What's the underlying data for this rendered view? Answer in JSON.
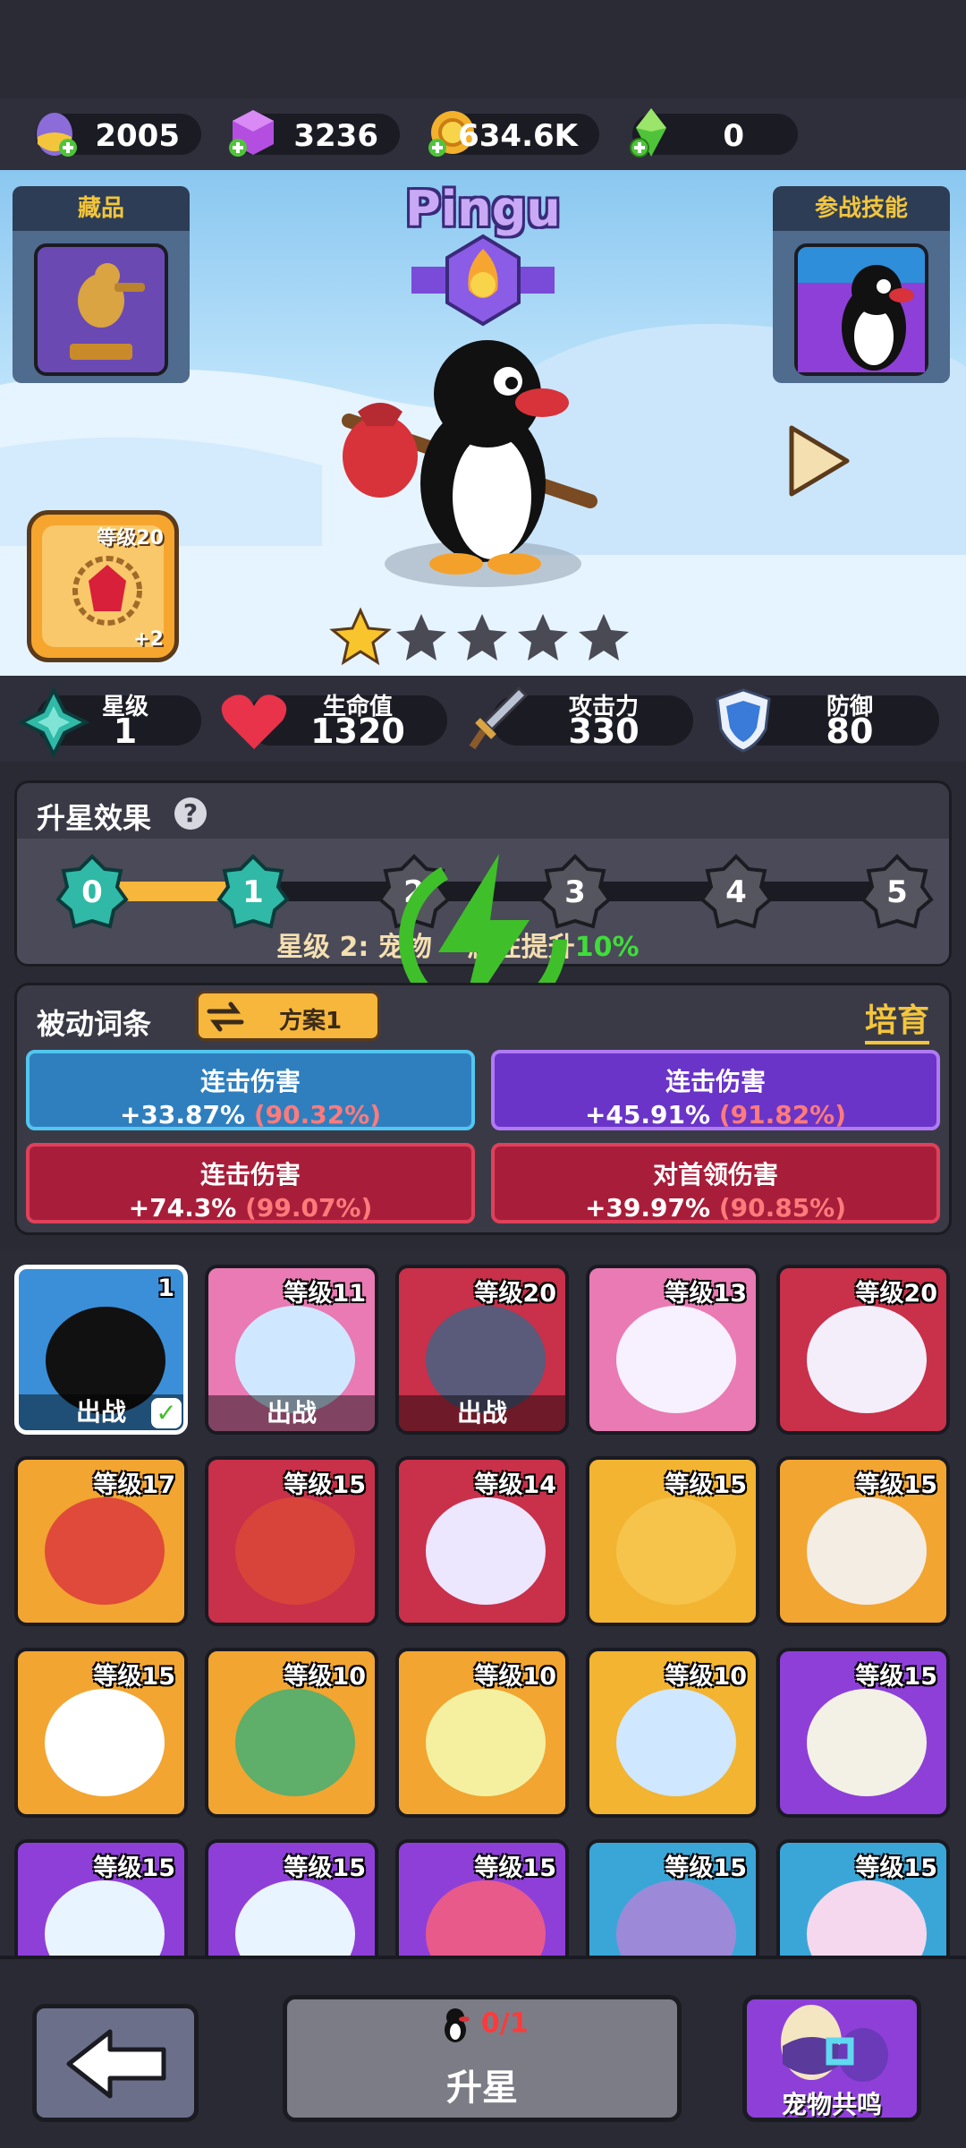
{
  "resources": [
    {
      "icon": "egg-icon",
      "value": "2005"
    },
    {
      "icon": "purple-gem-icon",
      "value": "3236"
    },
    {
      "icon": "gold-coin-icon",
      "value": "634.6K"
    },
    {
      "icon": "green-crystal-icon",
      "value": "0"
    }
  ],
  "hero": {
    "name": "Pingu",
    "collection_label": "藏品",
    "skill_label": "参战技能",
    "level_badge": "等级20",
    "level_plus": "+2",
    "stars_filled": 1,
    "stars_total": 5
  },
  "stats": [
    {
      "label": "星级",
      "value": "1",
      "icon": "star-rank-icon"
    },
    {
      "label": "生命值",
      "value": "1320",
      "icon": "heart-icon"
    },
    {
      "label": "攻击力",
      "value": "330",
      "icon": "sword-icon"
    },
    {
      "label": "防御",
      "value": "80",
      "icon": "shield-icon"
    }
  ],
  "star_effect": {
    "title": "升星效果",
    "help": "?",
    "nodes": [
      "0",
      "1",
      "2",
      "3",
      "4",
      "5"
    ],
    "current": 1,
    "desc_prefix": "星级 2: 宠物",
    "desc_mid": "属性提升",
    "desc_value": "10%"
  },
  "passive": {
    "title": "被动词条",
    "plan_label": "方案1",
    "cultivate_label": "培育",
    "affixes": [
      {
        "name": "连击伤害",
        "value": "+33.87%",
        "max": "(90.32%)",
        "color": "blue"
      },
      {
        "name": "连击伤害",
        "value": "+45.91%",
        "max": "(91.82%)",
        "color": "purple"
      },
      {
        "name": "连击伤害",
        "value": "+74.3%",
        "max": "(99.07%)",
        "color": "red"
      },
      {
        "name": "对首领伤害",
        "value": "+39.97%",
        "max": "(90.85%)",
        "color": "red"
      }
    ]
  },
  "pets": [
    {
      "level": "1",
      "status": "出战",
      "bg": "#3a8fd8",
      "face": "#111",
      "selected": true
    },
    {
      "level": "等级11",
      "status": "出战",
      "bg": "#e97ab3",
      "face": "#cfe8ff"
    },
    {
      "level": "等级20",
      "status": "出战",
      "bg": "#c9304a",
      "face": "#5a5a7a"
    },
    {
      "level": "等级13",
      "status": "",
      "bg": "#e97ab3",
      "face": "#f7f0ff"
    },
    {
      "level": "等级20",
      "status": "",
      "bg": "#c9304a",
      "face": "#f3eefa"
    },
    {
      "level": "等级17",
      "status": "",
      "bg": "#f2a531",
      "face": "#e04a3a"
    },
    {
      "level": "等级15",
      "status": "",
      "bg": "#c9304a",
      "face": "#d8443a"
    },
    {
      "level": "等级14",
      "status": "",
      "bg": "#c9304a",
      "face": "#ece6ff"
    },
    {
      "level": "等级15",
      "status": "",
      "bg": "#f2b431",
      "face": "#f6c44a"
    },
    {
      "level": "等级15",
      "status": "",
      "bg": "#f2a531",
      "face": "#f4ede4"
    },
    {
      "level": "等级15",
      "status": "",
      "bg": "#f2a531",
      "face": "#fff"
    },
    {
      "level": "等级10",
      "status": "",
      "bg": "#f2a531",
      "face": "#5fae6a"
    },
    {
      "level": "等级10",
      "status": "",
      "bg": "#f2a531",
      "face": "#f4f0a0"
    },
    {
      "level": "等级10",
      "status": "",
      "bg": "#f2b431",
      "face": "#cfe7ff"
    },
    {
      "level": "等级15",
      "status": "",
      "bg": "#8e3fd8",
      "face": "#f3f0e6"
    },
    {
      "level": "等级15",
      "status": "",
      "bg": "#8e3fd8",
      "face": "#e8f4ff"
    },
    {
      "level": "等级15",
      "status": "",
      "bg": "#8e3fd8",
      "face": "#e8f4ff"
    },
    {
      "level": "等级15",
      "status": "",
      "bg": "#8e3fd8",
      "face": "#e85a8a"
    },
    {
      "level": "等级15",
      "status": "",
      "bg": "#3aa6d8",
      "face": "#9c8ad8"
    },
    {
      "level": "等级15",
      "status": "",
      "bg": "#3aa6d8",
      "face": "#f5d8ee"
    }
  ],
  "bottom": {
    "upgrade_count": "0/1",
    "upgrade_label": "升星",
    "bond_label": "宠物共鸣"
  },
  "colors": {
    "accent_gold": "#f3c53c",
    "progress_gold": "#f6b73c",
    "highlight_green": "#3fdc3a",
    "max_red": "#ff7b7b"
  }
}
